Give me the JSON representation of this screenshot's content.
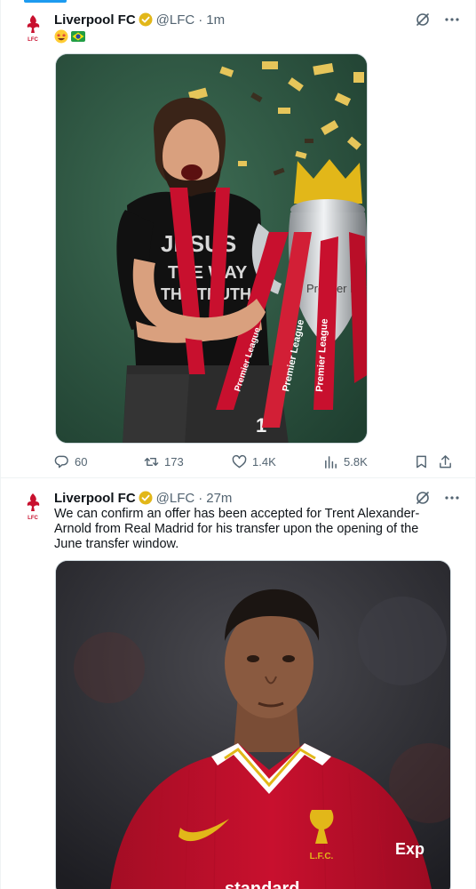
{
  "feed": {
    "tweets": [
      {
        "author_name": "Liverpool FC",
        "handle": "@LFC",
        "separator": "·",
        "time": "1m",
        "emojis": [
          "star-struck-emoji",
          "brazil-flag-emoji"
        ],
        "media_description_icon": "photo",
        "stats": {
          "replies": "60",
          "reposts": "173",
          "likes": "1.4K",
          "views": "5.8K"
        }
      },
      {
        "author_name": "Liverpool FC",
        "handle": "@LFC",
        "separator": "·",
        "time": "27m",
        "text": "We can confirm an offer has been accepted for Trent Alexander-Arnold from Real Madrid for his transfer upon the opening of the June transfer window."
      }
    ]
  },
  "colors": {
    "accent": "#1d9bf0",
    "verified_gold": "#e2b719",
    "lfc_red": "#c8102e",
    "secondary_text": "#536471"
  },
  "media_text": {
    "shirt_line1": "JESUS",
    "shirt_line2": "THE WAY",
    "shirt_line3": "THE TRUTH",
    "ribbon_text": "Premier League",
    "trophy_text": "Premier League",
    "shirt_number": "1",
    "crest_text": "L.F.C.",
    "sponsor": "standard",
    "sleeve_sponsor": "Exp"
  }
}
